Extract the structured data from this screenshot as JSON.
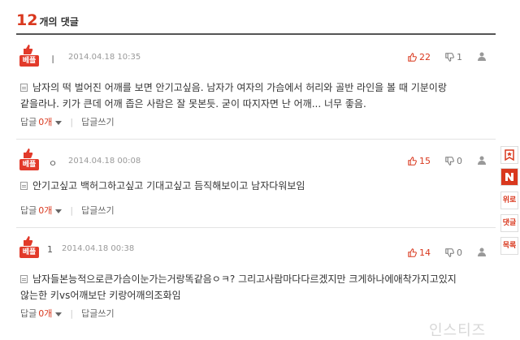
{
  "header": {
    "count": "12",
    "label": "개의 댓글"
  },
  "colors": {
    "accent": "#d9381e",
    "badge": "#e23a2a"
  },
  "comments": [
    {
      "badge": "베플",
      "author": "ㅣ",
      "date": "2014.04.18 10:35",
      "likes": "22",
      "dislikes": "1",
      "lines": [
        "남자의 떡 벌어진 어깨를 보면 안기고싶음. 남자가 여자의 가슴에서 허리와 골반 라인을 볼 때 기분이랑",
        "같을라나. 키가 큰데 어깨 좁은 사람은 잘 못본듯. 굳이 따지자면 난 어깨... 너무 좋음."
      ],
      "reply_label": "답글",
      "reply_count": "0개",
      "write_label": "답글쓰기"
    },
    {
      "badge": "베플",
      "author": "ㅇ",
      "date": "2014.04.18 00:08",
      "likes": "15",
      "dislikes": "0",
      "lines": [
        "안기고싶고 백허그하고싶고 기대고싶고 듬직해보이고 남자다워보임"
      ],
      "reply_label": "답글",
      "reply_count": "0개",
      "write_label": "답글쓰기"
    },
    {
      "badge": "베플",
      "author": "1",
      "date": "2014.04.18 00:38",
      "likes": "14",
      "dislikes": "0",
      "lines": [
        "남자들본능적으로큰가슴이눈가는거랑똑같음ㅇㅋ? 그리고사람마다다르겠지만 크게하나에애착가지고있지",
        "않는한 키vs어깨보단 키랑어깨의조화임"
      ],
      "reply_label": "답글",
      "reply_count": "0개",
      "write_label": "답글쓰기"
    }
  ],
  "side_menu": {
    "top_label": "위로",
    "comment_label": "댓글",
    "list_label": "목록"
  },
  "watermark": "인스티즈"
}
